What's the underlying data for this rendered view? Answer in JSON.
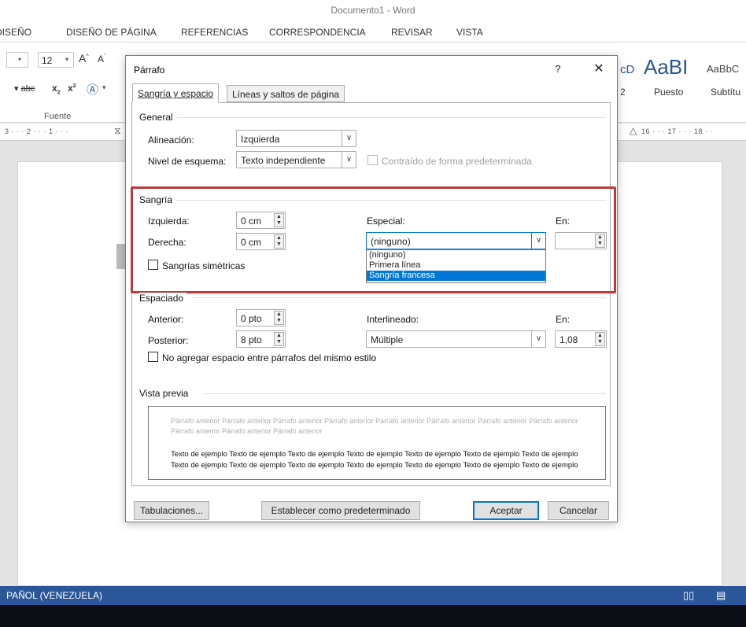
{
  "window": {
    "title": "Documento1 - Word"
  },
  "menu": [
    "DISEÑO",
    "DISEÑO DE PÁGINA",
    "REFERENCIAS",
    "CORRESPONDENCIA",
    "REVISAR",
    "VISTA"
  ],
  "ribbon": {
    "font_size": "12",
    "font_group_label": "Fuente",
    "styles": {
      "s1_preview": "cD",
      "s2_preview": "AaBI",
      "s3_preview": "AaBbC",
      "s1_label": "2",
      "s2_label": "Puesto",
      "s3_label": "Subtítu"
    }
  },
  "ruler": {
    "left": "3 · · · 2 · · · 1 · · ·",
    "right": "16 · · · 17 · · · 18 · ·"
  },
  "statusbar": {
    "language": "PAÑOL (VENEZUELA)"
  },
  "dialog": {
    "title": "Párrafo",
    "help": "?",
    "close": "✕",
    "tabs": [
      "Sangría y espacio",
      "Líneas y saltos de página"
    ],
    "general": {
      "heading": "General",
      "alignment_label": "Alineación:",
      "alignment_value": "Izquierda",
      "outline_label": "Nivel de esquema:",
      "outline_value": "Texto independiente",
      "collapsed_label": "Contraído de forma predeterminada"
    },
    "indent": {
      "heading": "Sangría",
      "left_label": "Izquierda:",
      "left_value": "0 cm",
      "right_label": "Derecha:",
      "right_value": "0 cm",
      "special_label": "Especial:",
      "special_value": "(ninguno)",
      "by_label": "En:",
      "by_value": "",
      "mirror_label": "Sangrías simétricas",
      "special_options": [
        "(ninguno)",
        "Primera línea",
        "Sangría francesa"
      ],
      "highlighted_option": "Sangría francesa"
    },
    "spacing": {
      "heading": "Espaciado",
      "before_label": "Anterior:",
      "before_value": "0 pto",
      "after_label": "Posterior:",
      "after_value": "8 pto",
      "line_label": "Interlineado:",
      "line_value": "Múltiple",
      "at_label": "En:",
      "at_value": "1,08",
      "no_space_label": "No agregar espacio entre párrafos del mismo estilo"
    },
    "preview": {
      "heading": "Vista previa",
      "previous_text": "Párrafo anterior Párrafo anterior Párrafo anterior Párrafo anterior Párrafo anterior Párrafo anterior Párrafo anterior Párrafo anterior Párrafo anterior Párrafo anterior Párrafo anterior",
      "sample_text": "Texto de ejemplo Texto de ejemplo Texto de ejemplo Texto de ejemplo Texto de ejemplo Texto de ejemplo Texto de ejemplo Texto de ejemplo Texto de ejemplo Texto de ejemplo Texto de ejemplo Texto de ejemplo Texto de ejemplo Texto de ejemplo"
    },
    "buttons": {
      "tabs": "Tabulaciones...",
      "set_default": "Establecer como predeterminado",
      "ok": "Aceptar",
      "cancel": "Cancelar"
    }
  },
  "colors": {
    "accent": "#2b579a",
    "highlight": "#c0393b",
    "selection": "#0078d7"
  }
}
